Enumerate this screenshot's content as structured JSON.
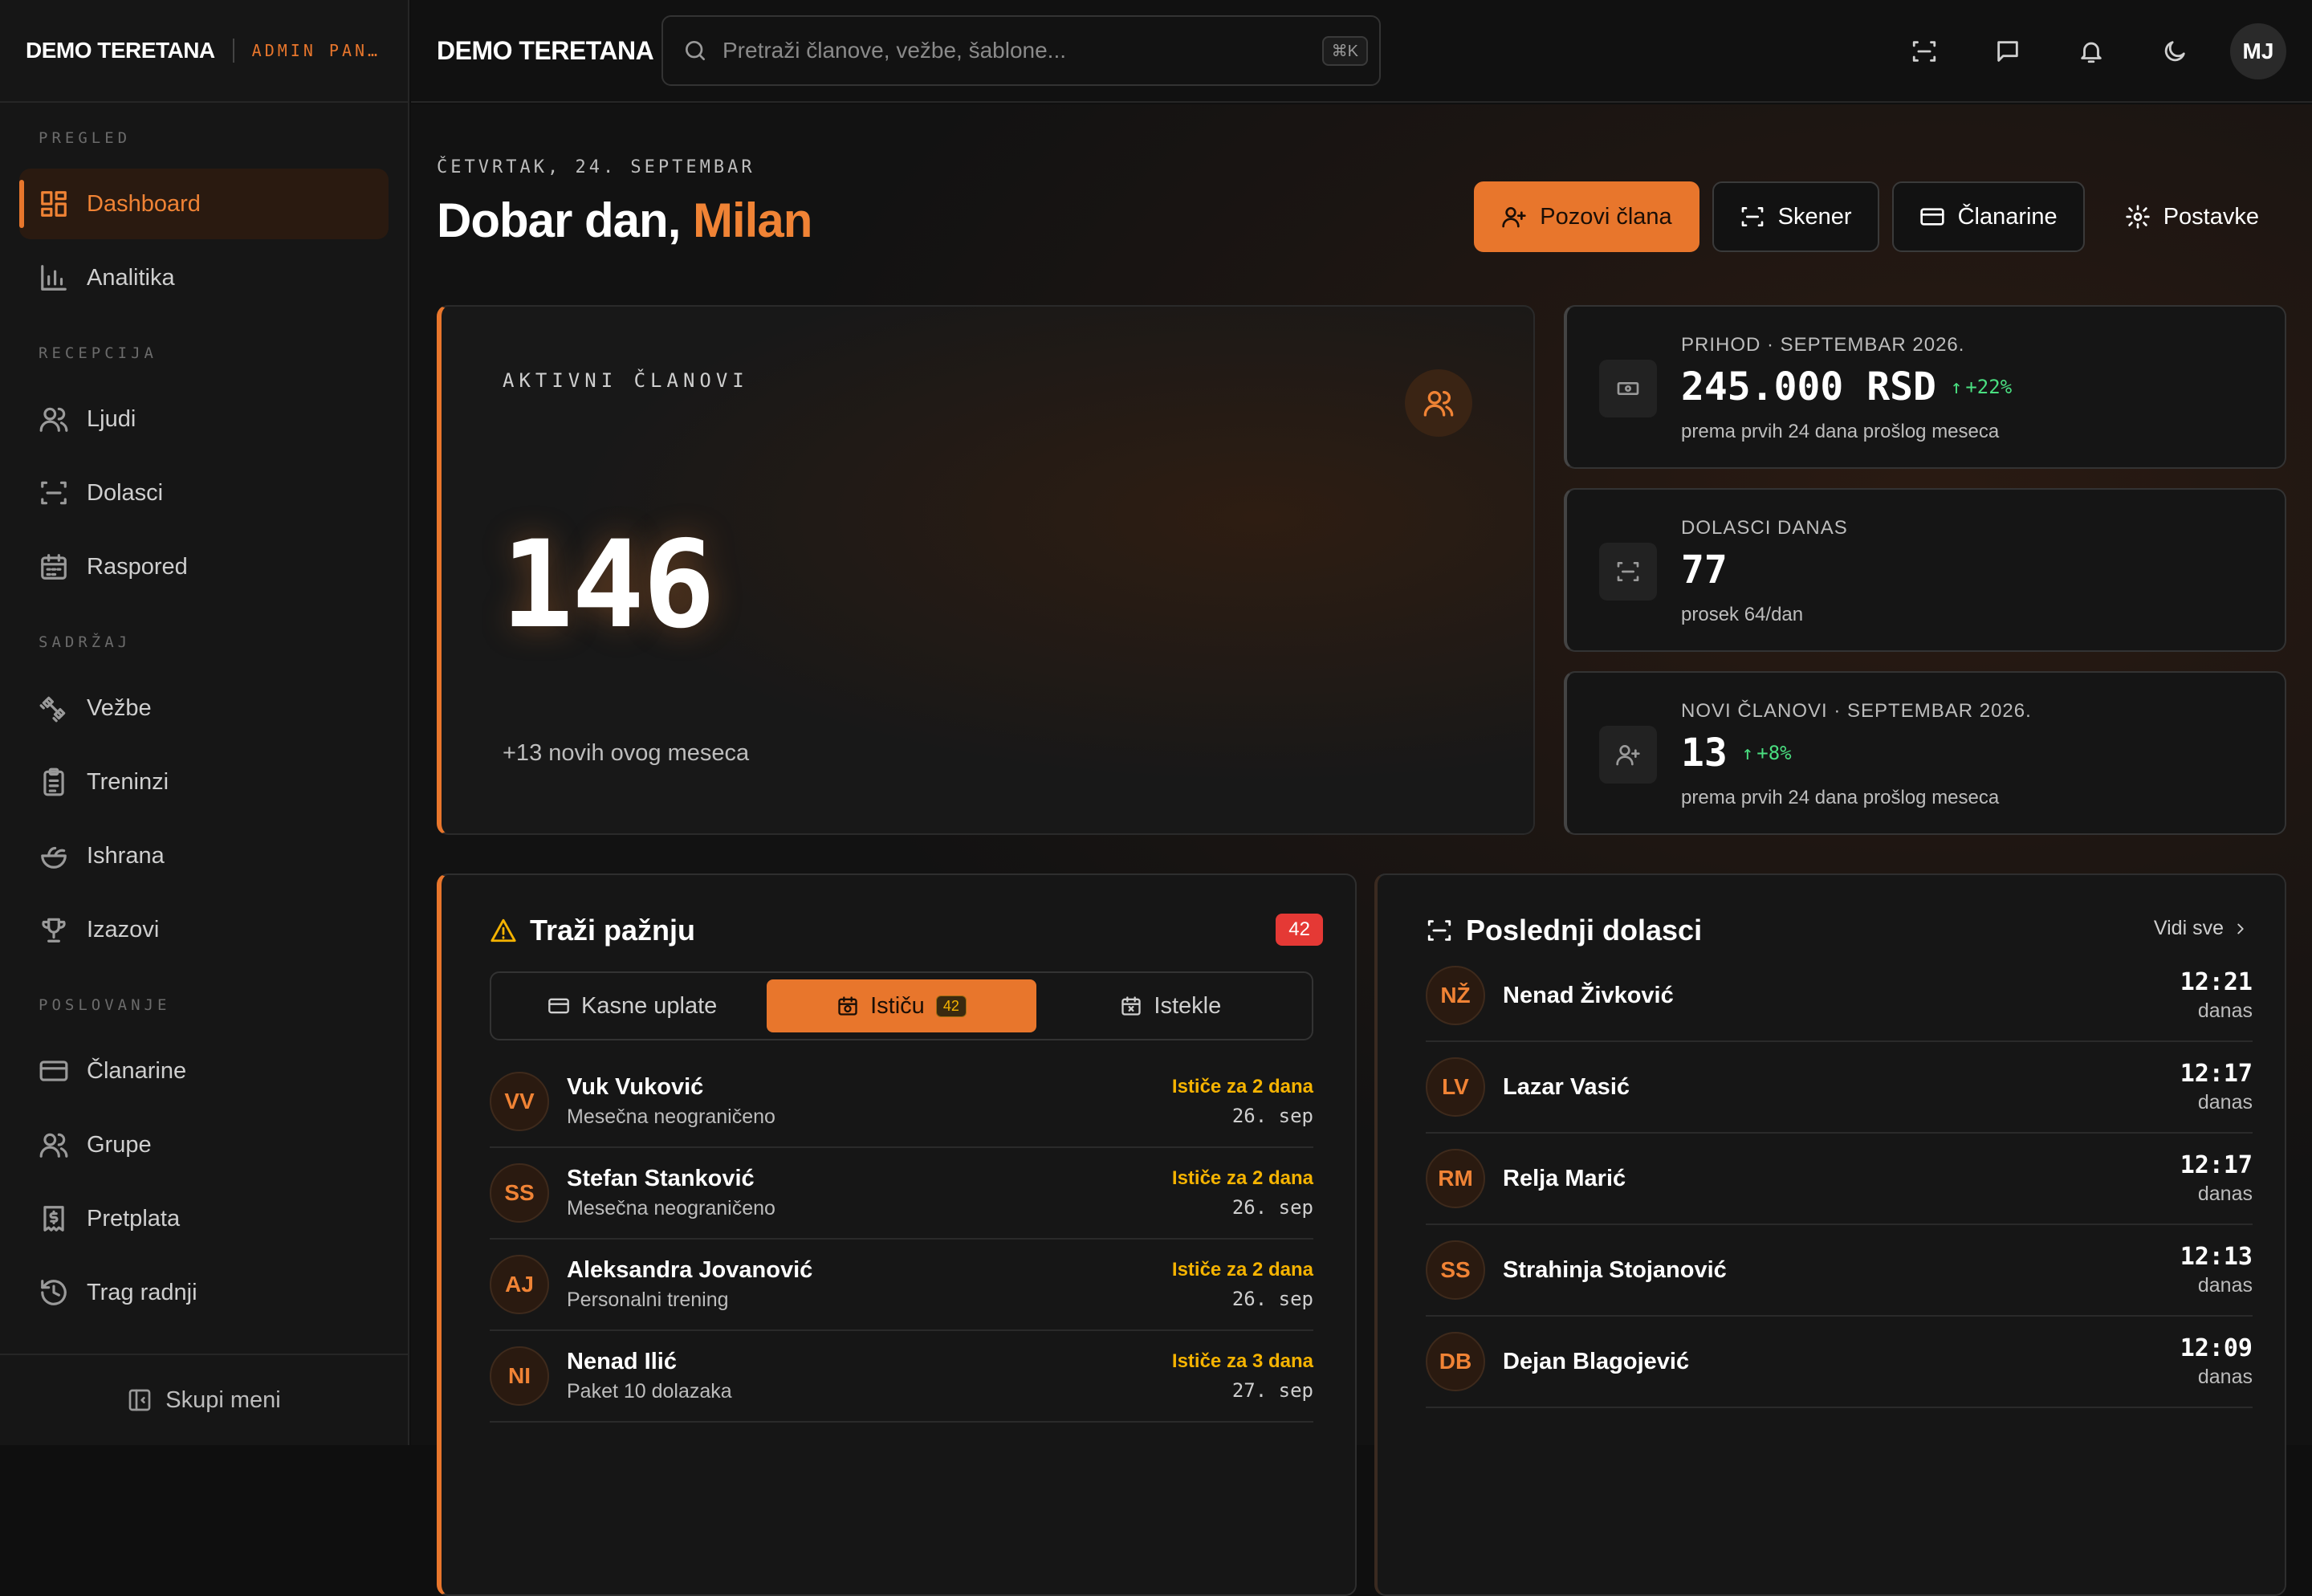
{
  "brand": {
    "name": "DEMO TERETANA",
    "sub": "ADMIN PAN…"
  },
  "sidebar": {
    "sections": [
      {
        "title": "PREGLED",
        "items": [
          {
            "label": "Dashboard",
            "icon": "dashboard-icon"
          },
          {
            "label": "Analitika",
            "icon": "bar-chart-icon"
          }
        ]
      },
      {
        "title": "RECEPCIJA",
        "items": [
          {
            "label": "Ljudi",
            "icon": "users-icon"
          },
          {
            "label": "Dolasci",
            "icon": "scan-icon"
          },
          {
            "label": "Raspored",
            "icon": "calendar-icon"
          }
        ]
      },
      {
        "title": "SADRŽAJ",
        "items": [
          {
            "label": "Vežbe",
            "icon": "dumbbell-icon"
          },
          {
            "label": "Treninzi",
            "icon": "clipboard-icon"
          },
          {
            "label": "Ishrana",
            "icon": "salad-icon"
          },
          {
            "label": "Izazovi",
            "icon": "trophy-icon"
          }
        ]
      },
      {
        "title": "POSLOVANJE",
        "items": [
          {
            "label": "Članarine",
            "icon": "card-icon"
          },
          {
            "label": "Grupe",
            "icon": "group-icon"
          },
          {
            "label": "Pretplata",
            "icon": "receipt-icon"
          },
          {
            "label": "Trag radnji",
            "icon": "history-icon"
          }
        ]
      }
    ],
    "collapse_label": "Skupi meni"
  },
  "topbar": {
    "title": "DEMO TERETANA",
    "search_placeholder": "Pretraži članove, vežbe, šablone...",
    "search_kbd": "⌘K",
    "avatar": "MJ"
  },
  "header": {
    "date": "ČETVRTAK, 24. SEPTEMBAR",
    "greeting": "Dobar dan,",
    "name": "Milan",
    "buttons": {
      "invite": "Pozovi člana",
      "scanner": "Skener",
      "memberships": "Članarine",
      "settings": "Postavke"
    }
  },
  "hero": {
    "label": "AKTIVNI ČLANOVI",
    "value": "146",
    "sub": "+13 novih ovog meseca"
  },
  "stats": [
    {
      "label": "PRIHOD · SEPTEMBAR 2026.",
      "value": "245.000 RSD",
      "delta": "+22%",
      "sub": "prema prvih 24 dana prošlog meseca",
      "icon": "cash-icon"
    },
    {
      "label": "DOLASCI DANAS",
      "value": "77",
      "delta": "",
      "sub": "prosek 64/dan",
      "icon": "scan-icon"
    },
    {
      "label": "NOVI ČLANOVI · SEPTEMBAR 2026.",
      "value": "13",
      "delta": "+8%",
      "sub": "prema prvih 24 dana prošlog meseca",
      "icon": "user-plus-icon"
    }
  ],
  "attention": {
    "title": "Traži pažnju",
    "badge": "42",
    "tabs": {
      "late": "Kasne uplate",
      "expiring": "Ističu",
      "expiring_count": "42",
      "expired": "Istekle"
    },
    "rows": [
      {
        "initials": "VV",
        "name": "Vuk Vuković",
        "plan": "Mesečna neograničeno",
        "status": "Ističe za 2 dana",
        "date": "26. sep"
      },
      {
        "initials": "SS",
        "name": "Stefan Stanković",
        "plan": "Mesečna neograničeno",
        "status": "Ističe za 2 dana",
        "date": "26. sep"
      },
      {
        "initials": "AJ",
        "name": "Aleksandra Jovanović",
        "plan": "Personalni trening",
        "status": "Ističe za 2 dana",
        "date": "26. sep"
      },
      {
        "initials": "NI",
        "name": "Nenad Ilić",
        "plan": "Paket 10 dolazaka",
        "status": "Ističe za 3 dana",
        "date": "27. sep"
      }
    ]
  },
  "recent": {
    "title": "Poslednji dolasci",
    "link": "Vidi sve",
    "rows": [
      {
        "initials": "NŽ",
        "name": "Nenad Živković",
        "time": "12:21",
        "day": "danas"
      },
      {
        "initials": "LV",
        "name": "Lazar Vasić",
        "time": "12:17",
        "day": "danas"
      },
      {
        "initials": "RM",
        "name": "Relja Marić",
        "time": "12:17",
        "day": "danas"
      },
      {
        "initials": "SS",
        "name": "Strahinja Stojanović",
        "time": "12:13",
        "day": "danas"
      },
      {
        "initials": "DB",
        "name": "Dejan Blagojević",
        "time": "12:09",
        "day": "danas"
      }
    ]
  },
  "colors": {
    "accent": "#e8762c",
    "warning": "#f5b301",
    "positive": "#4ade80",
    "danger": "#e53935"
  }
}
